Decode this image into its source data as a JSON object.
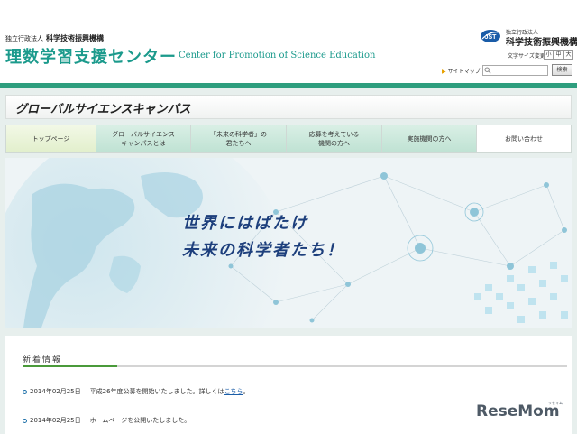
{
  "header": {
    "org_prefix": "独立行政法人",
    "org_name": "科学技術振興機構",
    "center_title": "理数学習支援センター",
    "center_en": "Center for Promotion of Science Education",
    "jst_logo_text": "JST",
    "jst_prefix": "独立行政法人",
    "jst_name": "科学技術振興機構",
    "fontsize_label": "文字サイズ変更",
    "fontsize_small": "小",
    "fontsize_medium": "中",
    "fontsize_large": "大",
    "sitemap_label": "サイトマップ",
    "search_value": "",
    "search_button": "検索"
  },
  "campus": {
    "title": "グローバルサイエンスキャンパス"
  },
  "nav": {
    "items": [
      {
        "label": "トップページ"
      },
      {
        "label": "グローバルサイエンス\nキャンパスとは"
      },
      {
        "label": "「未来の科学者」の\n君たちへ"
      },
      {
        "label": "応募を考えている\n機関の方へ"
      },
      {
        "label": "実施機関の方へ"
      },
      {
        "label": "お問い合わせ"
      }
    ]
  },
  "hero": {
    "line1": "世界にはばたけ",
    "line2": "未来の科学者たち！"
  },
  "news": {
    "title": "新着情報",
    "items": [
      {
        "date": "2014年02月25日",
        "text": "平成26年度公募を開始いたしました。詳しくは",
        "link": "こちら",
        "suffix": "。"
      },
      {
        "date": "2014年02月25日",
        "text": "ホームページを公開いたしました。",
        "link": "",
        "suffix": ""
      }
    ]
  },
  "watermark": {
    "text": "ReseMom",
    "kana": "リセマム"
  },
  "colors": {
    "brand_teal": "#1b9a8c",
    "green_bar": "#2e9e7e",
    "hero_text": "#1d3f7c",
    "link_blue": "#1c5ea8"
  }
}
